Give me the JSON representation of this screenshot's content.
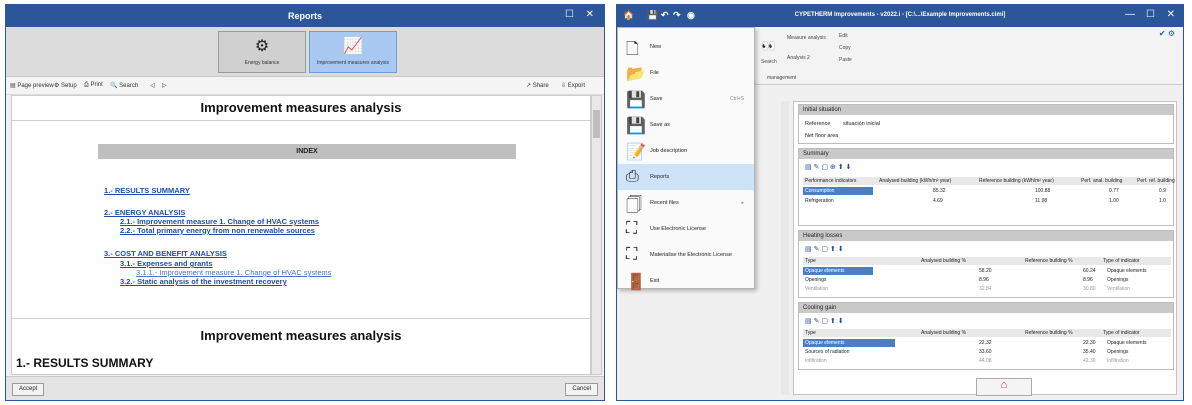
{
  "left": {
    "title": "Reports",
    "ribbon": [
      {
        "label": "Energy balance"
      },
      {
        "label": "Improvement measures analysis"
      }
    ],
    "toolbar": {
      "page_preview": "Page preview",
      "setup": "Setup",
      "print": "Print",
      "search": "Search",
      "share": "Share",
      "export": "Export"
    },
    "report_title": "Improvement measures analysis",
    "index_label": "INDEX",
    "links": {
      "l1": "1.- RESULTS SUMMARY",
      "l2": "2.- ENERGY ANALYSIS",
      "l21": "2.1.- Improvement measure 1. Change of HVAC systems",
      "l22": "2.2.- Total primary energy from non renewable sources",
      "l3": "3.- COST AND BENEFIT ANALYSIS",
      "l31": "3.1.- Expenses and grants",
      "l311": "3.1.1.- Improvement measure 1. Change of HVAC systems",
      "l32": "3.2.- Static analysis of the investment recovery"
    },
    "section_title": "Improvement measures analysis",
    "section_head": "1.- RESULTS SUMMARY",
    "footer": {
      "accept": "Accept",
      "cancel": "Cancel"
    }
  },
  "right": {
    "title": "CYPETHERM Improvements - v2022.i - [C:\\...\\Example Improvements.cimi]",
    "ribbon": {
      "search": "Search",
      "g1a": "Measure analysis",
      "g1b": "Analysis 2",
      "g2a": "Edit",
      "g2b": "Copy",
      "g2c": "Paste",
      "tab_label": "management"
    },
    "menu": [
      {
        "label": "New",
        "shortcut": ""
      },
      {
        "label": "File",
        "shortcut": ""
      },
      {
        "label": "Save",
        "shortcut": "Ctrl+S"
      },
      {
        "label": "Save as",
        "shortcut": ""
      },
      {
        "label": "Job description",
        "shortcut": ""
      },
      {
        "label": "Reports",
        "shortcut": ""
      },
      {
        "label": "Recent files",
        "shortcut": "▸"
      },
      {
        "label": "Use Electronic License",
        "shortcut": ""
      },
      {
        "label": "Materialise the Electronic License",
        "shortcut": ""
      },
      {
        "label": "Exit",
        "shortcut": ""
      }
    ],
    "main": {
      "header": "Initial situation",
      "reference_label": "Reference",
      "reference_value": "situación inicial",
      "floor_label": "Net floor area",
      "summary": {
        "header": "Summary",
        "cols": [
          "Performance indicators",
          "Analysed building (kWh/m² year)",
          "Reference building (kWh/m² year)",
          "Perf. anal. building",
          "Perf. ref. building"
        ],
        "rows": [
          [
            "Consumption",
            "85.32",
            "100.88",
            "0.77",
            "0.9"
          ],
          [
            "Refrigeration",
            "4.69",
            "11.98",
            "1.00",
            "1.0"
          ]
        ]
      },
      "heating": {
        "header": "Heating losses",
        "cols": [
          "Type",
          "Analysed building %",
          "Reference building %",
          "Type of indicator"
        ],
        "rows": [
          [
            "Opaque elements",
            "58.20",
            "60.24",
            "Opaque elements"
          ],
          [
            "Openings",
            "8.96",
            "8.96",
            "Openings"
          ],
          [
            "Ventilation",
            "32.84",
            "30.80",
            "Ventilation"
          ]
        ]
      },
      "cooling": {
        "header": "Cooling gain",
        "cols": [
          "Type",
          "Analysed building %",
          "Reference building %",
          "Type of indicator"
        ],
        "rows": [
          [
            "Opaque elements",
            "22.32",
            "22.30",
            "Opaque elements"
          ],
          [
            "Sources of radiation",
            "33.60",
            "35.40",
            "Openings"
          ],
          [
            "Infiltration",
            "44.08",
            "42.30",
            "Infiltration"
          ]
        ]
      }
    }
  }
}
